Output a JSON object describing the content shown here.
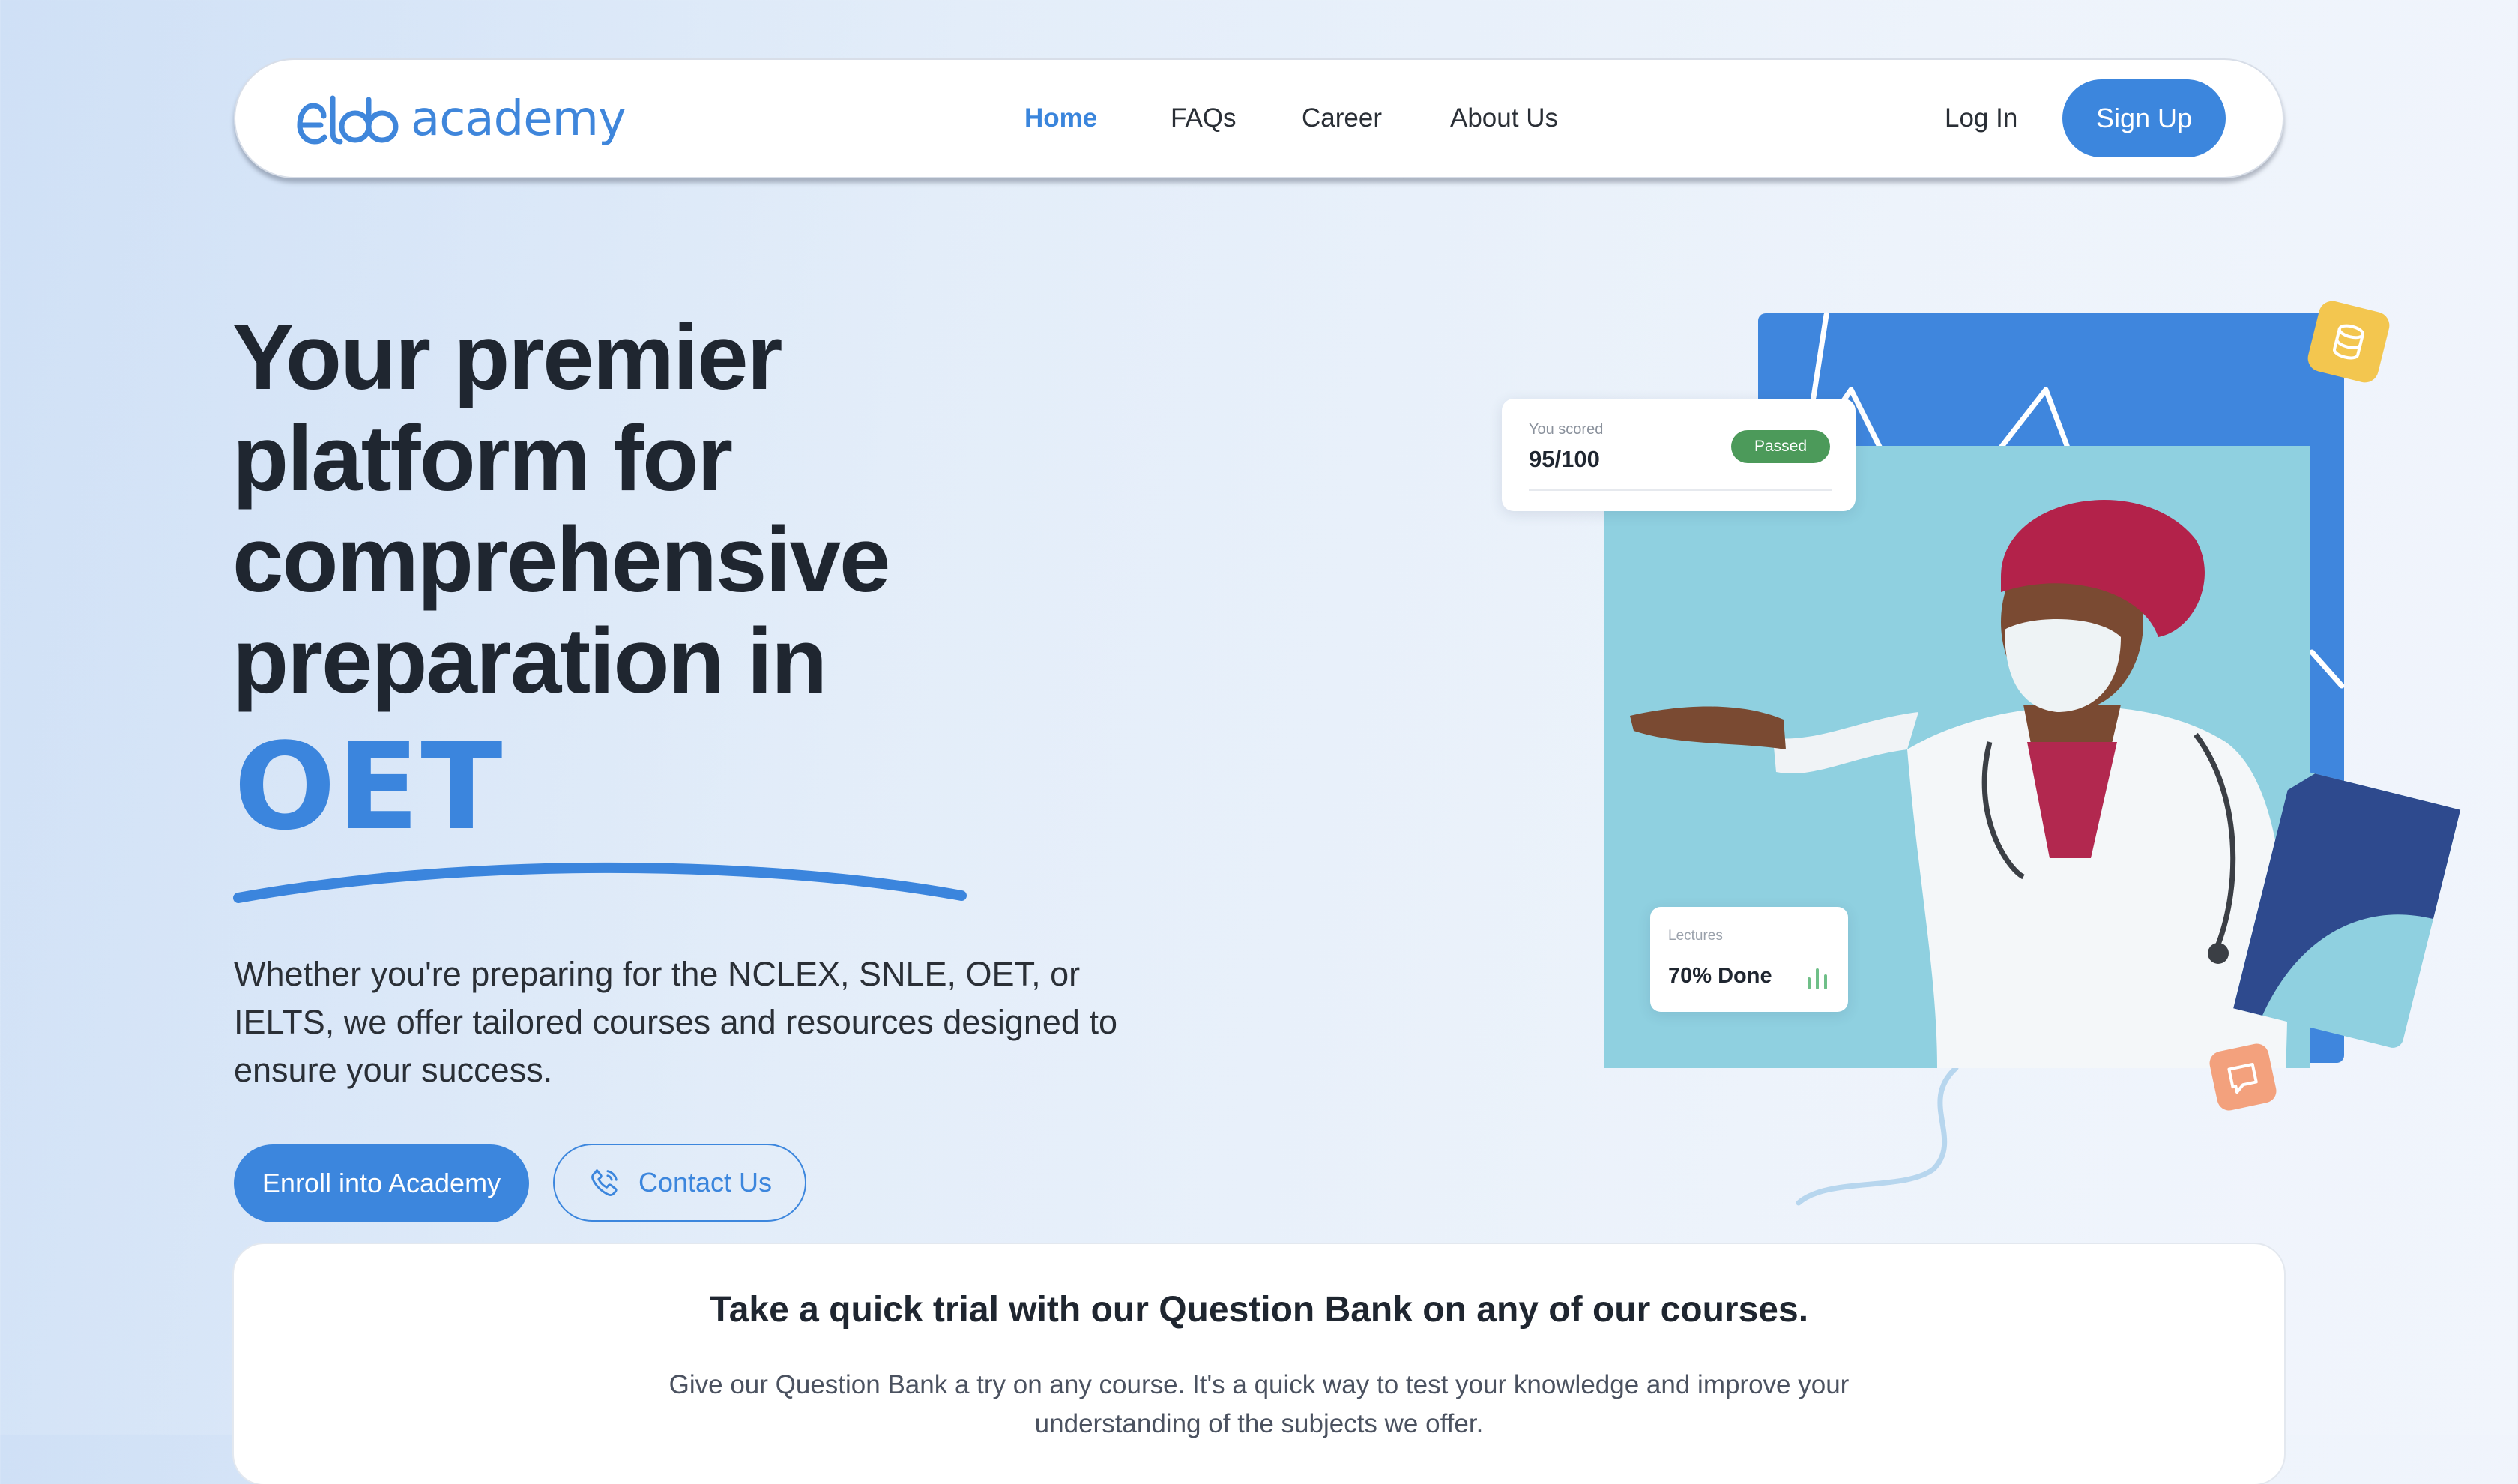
{
  "colors": {
    "accent": "#3c86dd",
    "heading": "#1f2630",
    "passed_badge": "#4c9a5a",
    "illustration_blue": "#3f86dd",
    "illustration_teal": "#8fd0e0",
    "illustration_navy": "#2e4a8e"
  },
  "header": {
    "logo_text": "academy",
    "nav": [
      {
        "label": "Home",
        "active": true
      },
      {
        "label": "FAQs",
        "active": false
      },
      {
        "label": "Career",
        "active": false
      },
      {
        "label": "About Us",
        "active": false
      }
    ],
    "login_label": "Log In",
    "signup_label": "Sign Up"
  },
  "hero": {
    "title": "Your premier platform for comprehensive preparation in",
    "accent": "OET",
    "description": "Whether you're preparing for the NCLEX, SNLE, OET, or IELTS, we offer tailored courses and resources designed to ensure your success.",
    "enroll_label": "Enroll into Academy",
    "contact_label": "Contact Us",
    "contact_icon": "phone-icon"
  },
  "illustration": {
    "score_card": {
      "label": "You scored",
      "value": "95/100",
      "badge": "Passed"
    },
    "lectures_card": {
      "label": "Lectures",
      "value": "70% Done",
      "icon": "bar-chart-icon"
    },
    "badges": [
      "database-icon",
      "chat-icon"
    ]
  },
  "trial": {
    "title": "Take a quick trial with our Question Bank on any of our courses.",
    "description": "Give our Question Bank a try on any course. It's a quick way to test your knowledge and improve your understanding of the subjects we offer."
  }
}
